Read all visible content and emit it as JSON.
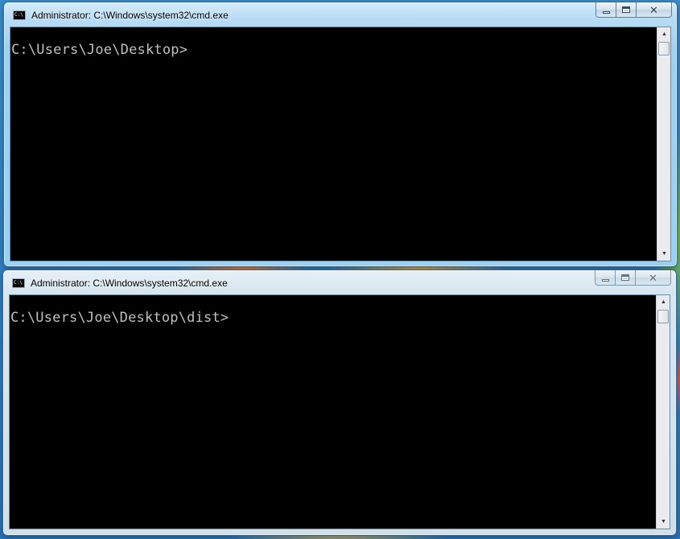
{
  "windows": [
    {
      "title": "Administrator: C:\\Windows\\system32\\cmd.exe",
      "state": "active",
      "console_lines": "C:\\Users\\Joe\\Desktop>"
    },
    {
      "title": "Administrator: C:\\Windows\\system32\\cmd.exe",
      "state": "inactive",
      "console_lines": "C:\\Users\\Joe\\Desktop\\dist>"
    }
  ],
  "icons": {
    "app": "cmd-icon",
    "minimize": "minimize-icon",
    "maximize": "maximize-icon",
    "close": "close-icon",
    "scroll_up": "arrow-up-icon",
    "scroll_down": "arrow-down-icon"
  },
  "glyphs": {
    "app_icon_text": "C:\\",
    "close": "✕",
    "up": "▲",
    "down": "▼"
  },
  "colors": {
    "console_bg": "#000000",
    "console_fg": "#c0c0c0",
    "active_frame": "#9fd0f1",
    "inactive_frame": "#cfe0ea"
  }
}
